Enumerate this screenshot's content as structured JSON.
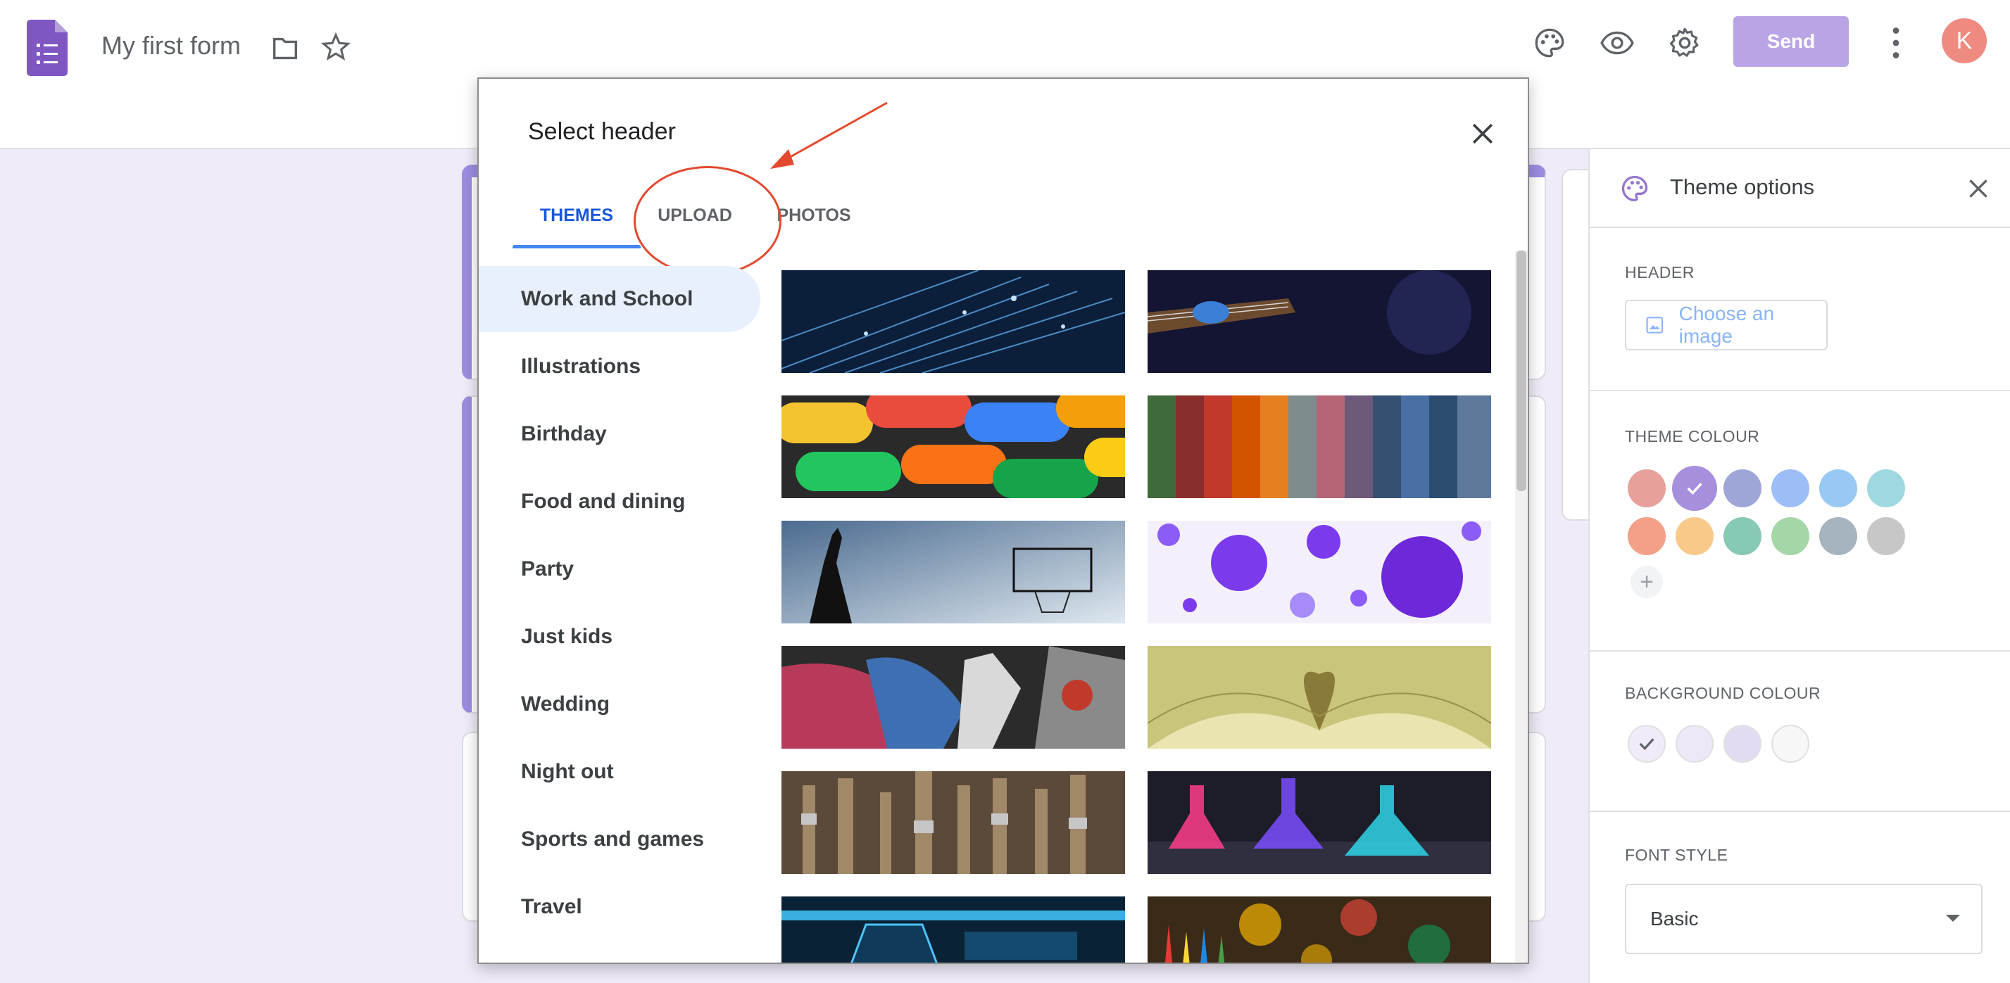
{
  "topbar": {
    "form_title": "My first form",
    "send_label": "Send",
    "avatar_initial": "K"
  },
  "theme_panel": {
    "title": "Theme options",
    "header_label": "HEADER",
    "choose_image_label": "Choose an image",
    "theme_colour_label": "THEME COLOUR",
    "background_colour_label": "BACKGROUND COLOUR",
    "font_style_label": "FONT STYLE",
    "font_style_value": "Basic",
    "theme_colours": [
      "#e8a09a",
      "#a68fdd",
      "#9ea6d8",
      "#9cbdf7",
      "#97c9f4",
      "#9fd8e0",
      "#f4a088",
      "#f9c98a",
      "#88c9b6",
      "#a5d6a7",
      "#a6b4c0",
      "#c7c7c7"
    ],
    "selected_theme_colour": "#a68fdd",
    "background_colours": [
      "#f0ebf8",
      "#ece8f7",
      "#e2dcf3",
      "#f7f7f7"
    ]
  },
  "modal": {
    "title": "Select header",
    "tabs": [
      "THEMES",
      "UPLOAD",
      "PHOTOS"
    ],
    "active_tab": "THEMES",
    "categories": [
      "Work and School",
      "Illustrations",
      "Birthday",
      "Food and dining",
      "Party",
      "Just kids",
      "Wedding",
      "Night out",
      "Sports and games",
      "Travel"
    ],
    "active_category": "Work and School",
    "thumbnails": [
      "fiber optic light streaks",
      "guitarist on stage",
      "colourful candies",
      "coloured yarn strands",
      "basketball player silhouette",
      "purple bubbles",
      "painted hands",
      "open book heart pages",
      "paint brushes",
      "lab flasks",
      "blue machine",
      "coloured pencils bokeh"
    ]
  }
}
